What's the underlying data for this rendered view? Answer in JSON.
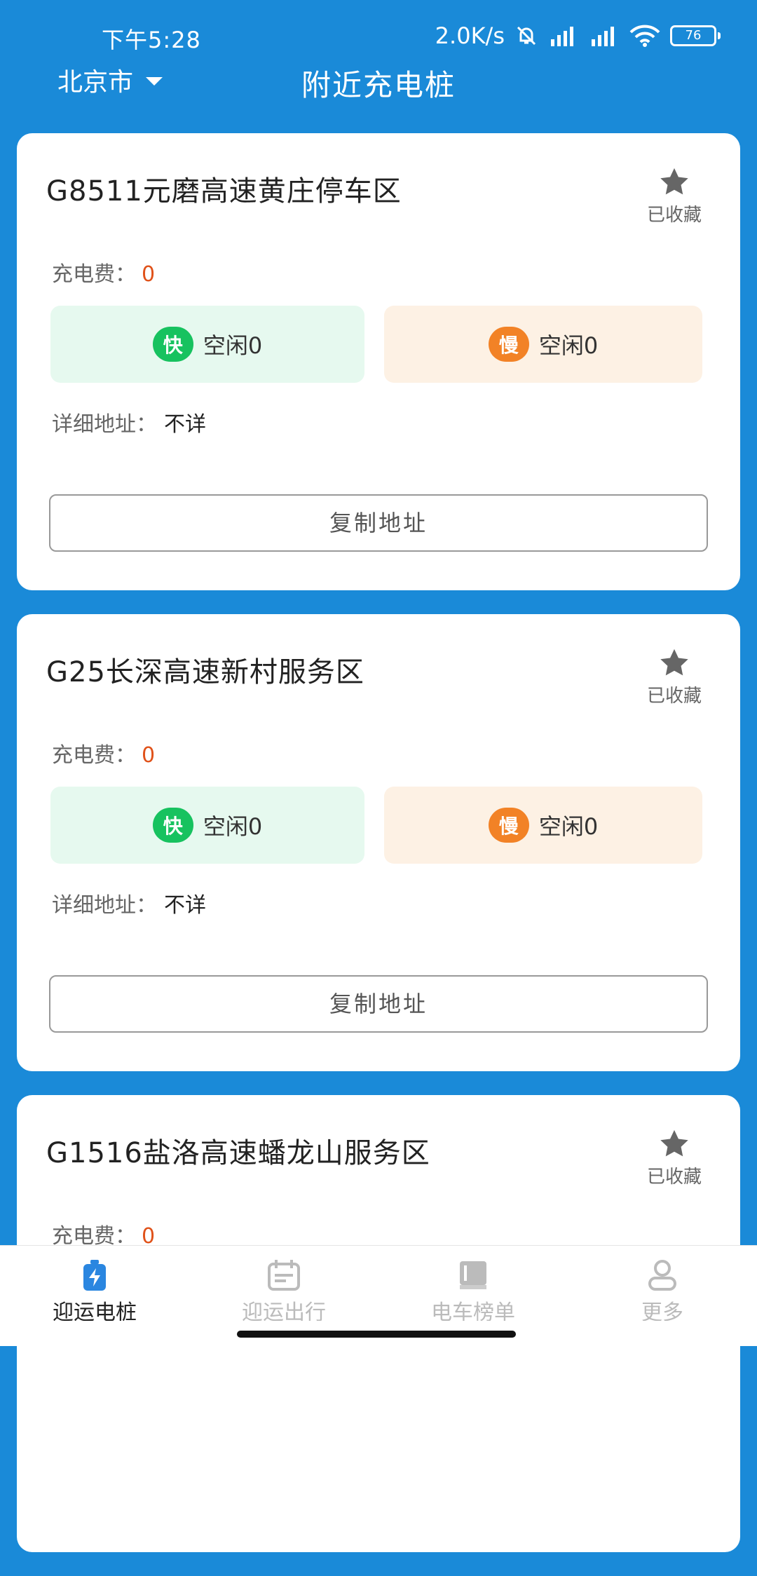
{
  "status": {
    "time": "下午5:28",
    "net_speed": "2.0K/s",
    "battery": "76"
  },
  "header": {
    "city": "北京市",
    "title": "附近充电桩"
  },
  "stations": [
    {
      "name": "G8511元磨高速黄庄停车区",
      "fav_label": "已收藏",
      "fee_label": "充电费：",
      "fee": "0",
      "fast_badge": "快",
      "fast_text": "空闲0",
      "slow_badge": "慢",
      "slow_text": "空闲0",
      "addr_label": "详细地址：",
      "addr": "不详",
      "copy_label": "复制地址"
    },
    {
      "name": "G25长深高速新村服务区",
      "fav_label": "已收藏",
      "fee_label": "充电费：",
      "fee": "0",
      "fast_badge": "快",
      "fast_text": "空闲0",
      "slow_badge": "慢",
      "slow_text": "空闲0",
      "addr_label": "详细地址：",
      "addr": "不详",
      "copy_label": "复制地址"
    },
    {
      "name": "G1516盐洛高速蟠龙山服务区",
      "fav_label": "已收藏",
      "fee_label": "充电费：",
      "fee": "0"
    }
  ],
  "nav": [
    {
      "label": "迎运电桩",
      "icon": "charging-station-icon",
      "active": true
    },
    {
      "label": "迎运出行",
      "icon": "calendar-icon",
      "active": false
    },
    {
      "label": "电车榜单",
      "icon": "book-icon",
      "active": false
    },
    {
      "label": "更多",
      "icon": "person-icon",
      "active": false
    }
  ],
  "colors": {
    "primary": "#1a8ad8",
    "fee": "#e0521a",
    "fast": "#17c25f",
    "slow": "#f28226"
  }
}
